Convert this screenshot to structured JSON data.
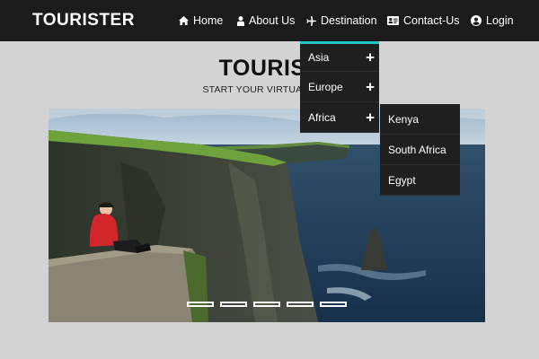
{
  "brand": "TOURISTER",
  "nav": {
    "home": "Home",
    "about": "About Us",
    "destination": "Destination",
    "contact": "Contact-Us",
    "login": "Login"
  },
  "hero": {
    "title": "TOURIST",
    "subtitle": "START YOUR VIRTUAL JOUR"
  },
  "dropdown": {
    "items": [
      {
        "label": "Asia",
        "expand": "+"
      },
      {
        "label": "Europe",
        "expand": "+"
      },
      {
        "label": "Africa",
        "expand": "+"
      }
    ]
  },
  "submenu": {
    "items": [
      "Kenya",
      "South Africa",
      "Egypt"
    ]
  },
  "carousel": {
    "slide_count": 5,
    "image": "cliffs-of-moher-hiker"
  },
  "colors": {
    "navbar": "#1b1b1b",
    "accent": "#1ec3c3",
    "page_bg": "#d3d3d3",
    "menu_bg": "#1f1f1f"
  },
  "icons": [
    "home-icon",
    "user-icon",
    "plane-icon",
    "contact-card-icon",
    "user-circle-icon",
    "plus-icon"
  ]
}
